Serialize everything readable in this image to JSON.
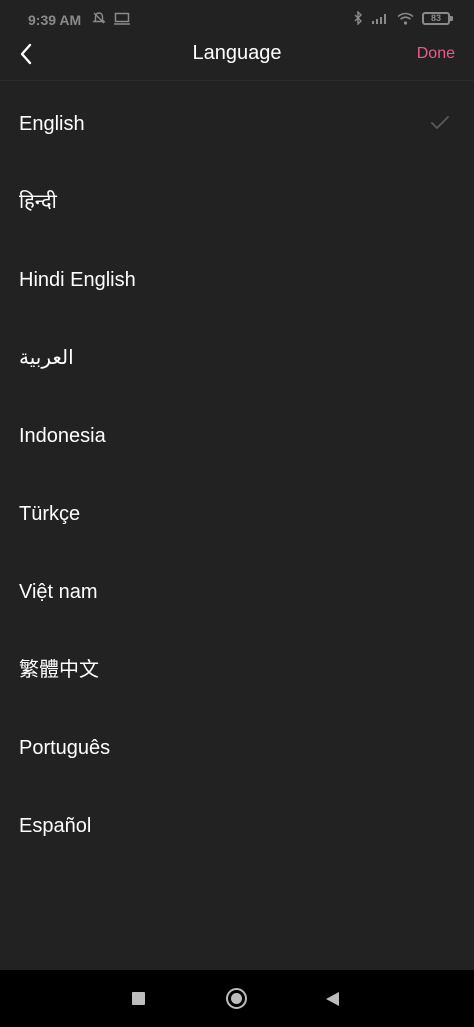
{
  "status_bar": {
    "time": "9:39 AM",
    "battery": "83",
    "left_icons": [
      "alarm-icon",
      "cast-icon"
    ],
    "right_icons": [
      "bluetooth-icon",
      "signal-icon",
      "wifi-icon",
      "battery-icon"
    ]
  },
  "header": {
    "title": "Language",
    "done_label": "Done",
    "back_icon": "chevron-left-icon"
  },
  "colors": {
    "background": "#222222",
    "accent": "#ee5a8a",
    "text": "#ffffff",
    "check": "#5a5a5a"
  },
  "languages": [
    {
      "label": "English",
      "selected": true
    },
    {
      "label": "हिन्दी",
      "selected": false
    },
    {
      "label": "Hindi English",
      "selected": false
    },
    {
      "label": "العربية",
      "selected": false
    },
    {
      "label": "Indonesia",
      "selected": false
    },
    {
      "label": "Türkçe",
      "selected": false
    },
    {
      "label": "Việt nam",
      "selected": false
    },
    {
      "label": "繁體中文",
      "selected": false
    },
    {
      "label": "Português",
      "selected": false
    },
    {
      "label": "Español",
      "selected": false
    }
  ],
  "nav_bar": {
    "buttons": [
      "recent-apps-icon",
      "home-icon",
      "back-triangle-icon"
    ]
  }
}
